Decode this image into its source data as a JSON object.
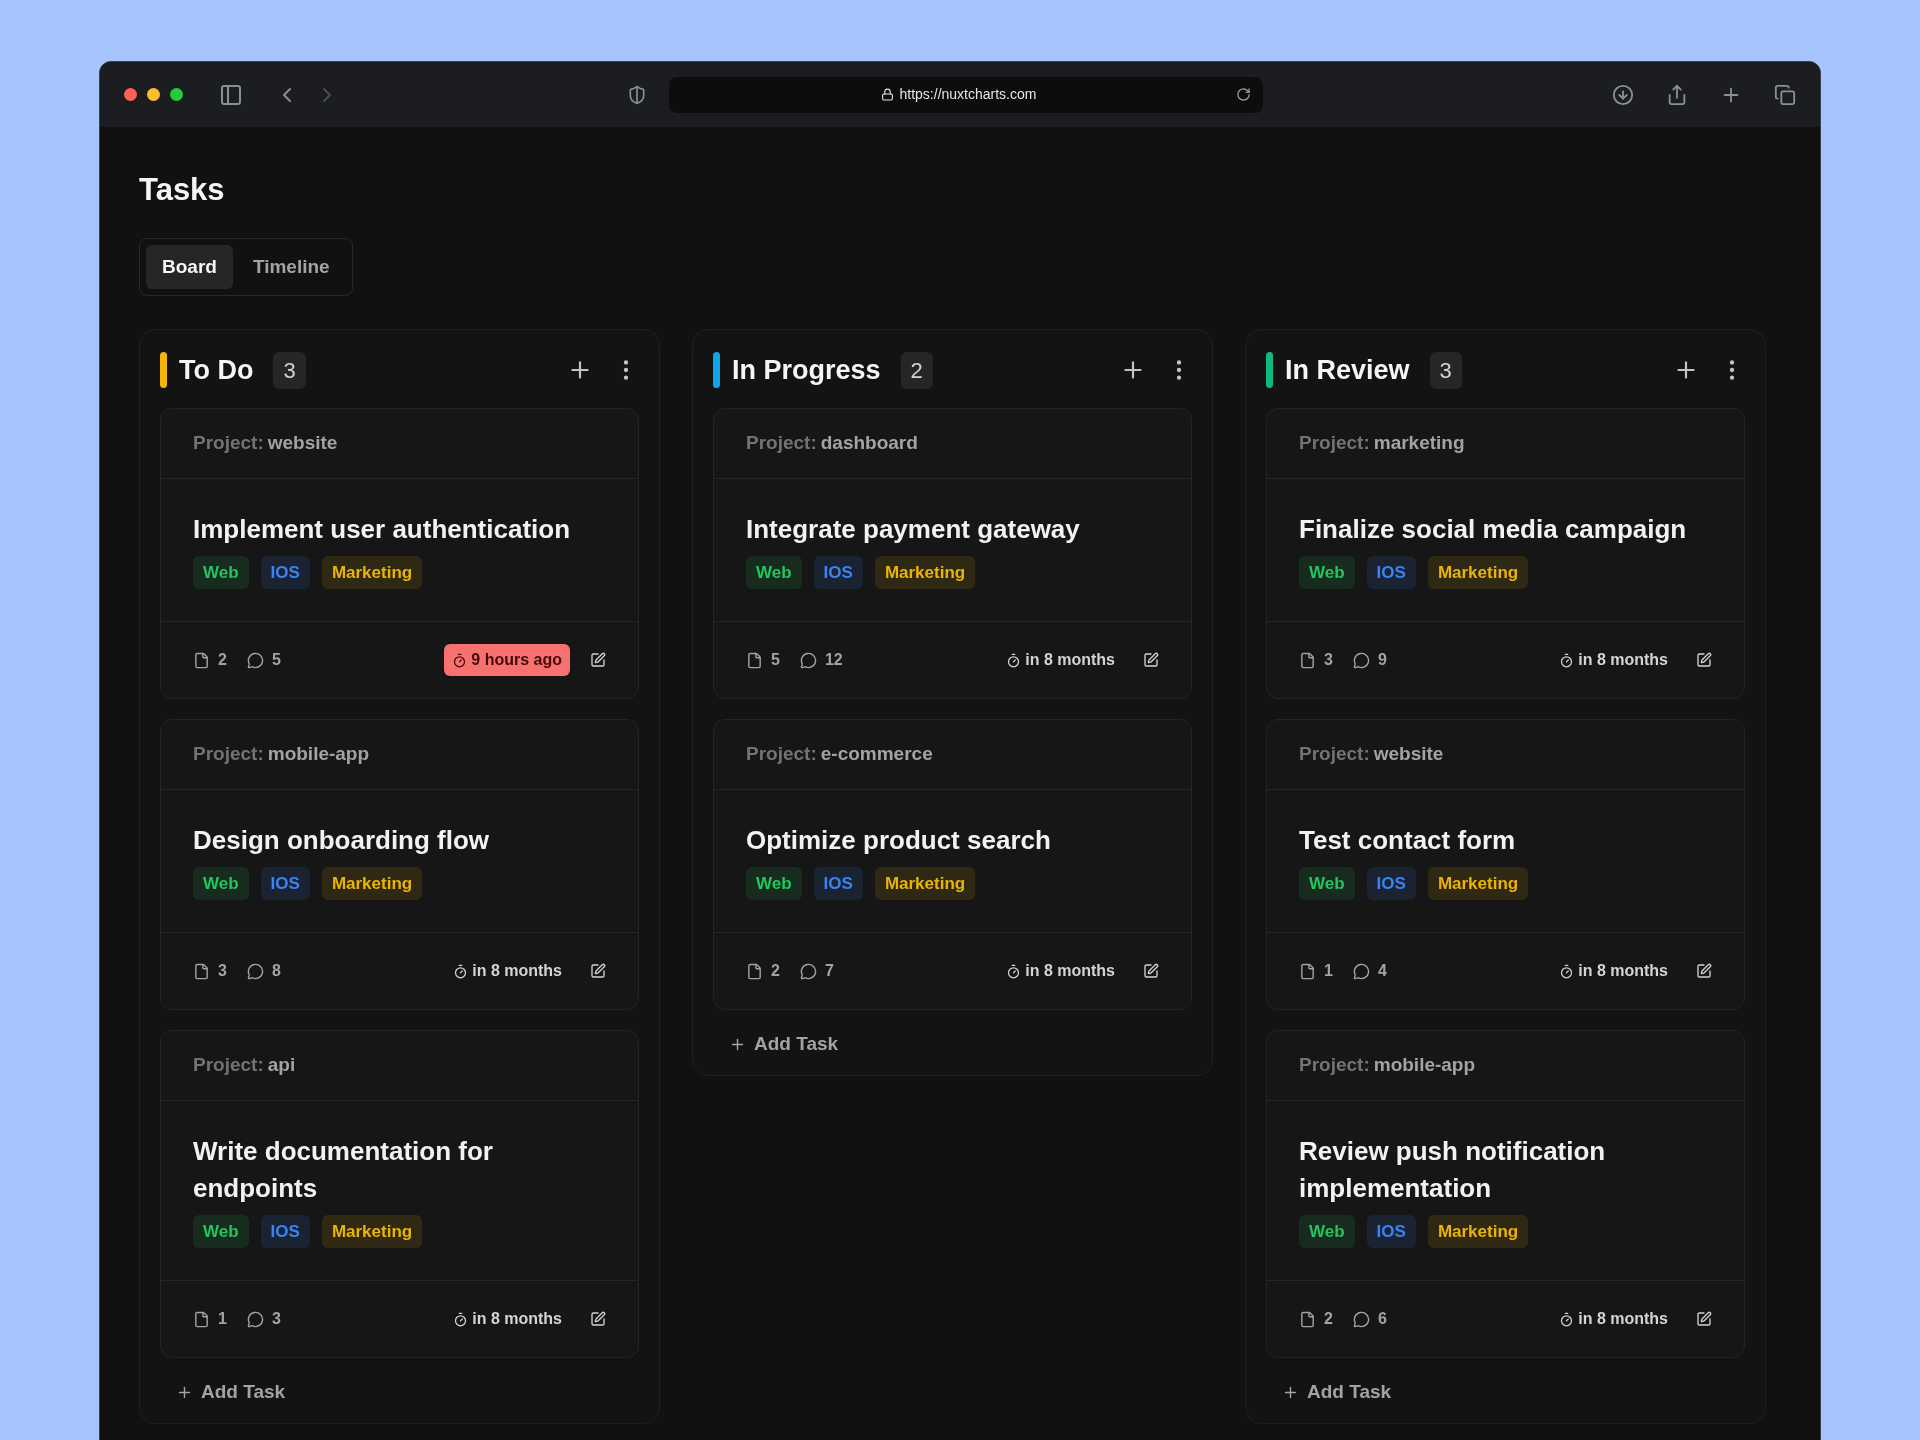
{
  "browser": {
    "url": "https://nuxtcharts.com"
  },
  "page_title": "Tasks",
  "tabs": [
    {
      "label": "Board",
      "selected": true
    },
    {
      "label": "Timeline",
      "selected": false
    }
  ],
  "columns": [
    {
      "title": "To Do",
      "count": "3",
      "color": "#f5b40a",
      "add_task": "Add Task",
      "cards": [
        {
          "project_label": "Project:",
          "project": "website",
          "title": "Implement user authentication",
          "tags": [
            {
              "label": "Web",
              "color": "#22c55e"
            },
            {
              "label": "IOS",
              "color": "#3b82f6"
            },
            {
              "label": "Marketing",
              "color": "#eab308"
            }
          ],
          "files": "2",
          "comments": "5",
          "due": "9 hours ago",
          "overdue": true
        },
        {
          "project_label": "Project:",
          "project": "mobile-app",
          "title": "Design onboarding flow",
          "tags": [
            {
              "label": "Web",
              "color": "#22c55e"
            },
            {
              "label": "IOS",
              "color": "#3b82f6"
            },
            {
              "label": "Marketing",
              "color": "#eab308"
            }
          ],
          "files": "3",
          "comments": "8",
          "due": "in 8 months",
          "overdue": false
        },
        {
          "project_label": "Project:",
          "project": "api",
          "title": "Write documentation for endpoints",
          "tags": [
            {
              "label": "Web",
              "color": "#22c55e"
            },
            {
              "label": "IOS",
              "color": "#3b82f6"
            },
            {
              "label": "Marketing",
              "color": "#eab308"
            }
          ],
          "files": "1",
          "comments": "3",
          "due": "in 8 months",
          "overdue": false
        }
      ]
    },
    {
      "title": "In Progress",
      "count": "2",
      "color": "#0ea5e9",
      "add_task": "Add Task",
      "cards": [
        {
          "project_label": "Project:",
          "project": "dashboard",
          "title": "Integrate payment gateway",
          "tags": [
            {
              "label": "Web",
              "color": "#22c55e"
            },
            {
              "label": "IOS",
              "color": "#3b82f6"
            },
            {
              "label": "Marketing",
              "color": "#eab308"
            }
          ],
          "files": "5",
          "comments": "12",
          "due": "in 8 months",
          "overdue": false
        },
        {
          "project_label": "Project:",
          "project": "e-commerce",
          "title": "Optimize product search",
          "tags": [
            {
              "label": "Web",
              "color": "#22c55e"
            },
            {
              "label": "IOS",
              "color": "#3b82f6"
            },
            {
              "label": "Marketing",
              "color": "#eab308"
            }
          ],
          "files": "2",
          "comments": "7",
          "due": "in 8 months",
          "overdue": false
        }
      ]
    },
    {
      "title": "In Review",
      "count": "3",
      "color": "#10b981",
      "add_task": "Add Task",
      "cards": [
        {
          "project_label": "Project:",
          "project": "marketing",
          "title": "Finalize social media campaign",
          "tags": [
            {
              "label": "Web",
              "color": "#22c55e"
            },
            {
              "label": "IOS",
              "color": "#3b82f6"
            },
            {
              "label": "Marketing",
              "color": "#eab308"
            }
          ],
          "files": "3",
          "comments": "9",
          "due": "in 8 months",
          "overdue": false
        },
        {
          "project_label": "Project:",
          "project": "website",
          "title": "Test contact form",
          "tags": [
            {
              "label": "Web",
              "color": "#22c55e"
            },
            {
              "label": "IOS",
              "color": "#3b82f6"
            },
            {
              "label": "Marketing",
              "color": "#eab308"
            }
          ],
          "files": "1",
          "comments": "4",
          "due": "in 8 months",
          "overdue": false
        },
        {
          "project_label": "Project:",
          "project": "mobile-app",
          "title": "Review push notification implementation",
          "tags": [
            {
              "label": "Web",
              "color": "#22c55e"
            },
            {
              "label": "IOS",
              "color": "#3b82f6"
            },
            {
              "label": "Marketing",
              "color": "#eab308"
            }
          ],
          "files": "2",
          "comments": "6",
          "due": "in 8 months",
          "overdue": false
        }
      ]
    }
  ]
}
